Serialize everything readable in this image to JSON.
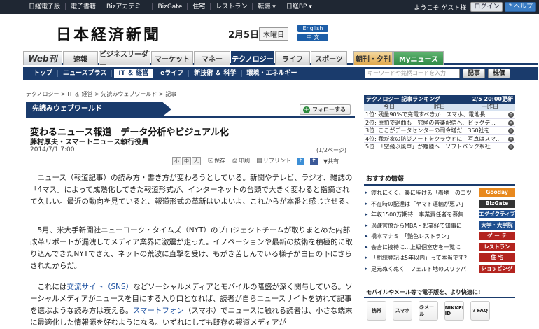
{
  "topbar": {
    "links": [
      "日経電子版",
      "電子書籍",
      "Bizアカデミー",
      "BizGate",
      "住宅",
      "レストラン",
      "転職 ▾",
      "日経BP ▾"
    ],
    "greeting": "ようこそ ゲスト様",
    "login": "ログイン",
    "help": "? ヘルプ"
  },
  "header": {
    "logo": "日本経済新聞",
    "date": "2月5日",
    "weekday": "木曜日",
    "lang_en": "English",
    "lang_cn": "中 文"
  },
  "mainnav": {
    "web": "Web刊",
    "tabs": [
      "速報",
      "ビジネスリーダー",
      "マーケット",
      "マネー",
      "テクノロジー",
      "ライフ",
      "スポーツ"
    ],
    "yuukan": "朝刊・夕刊",
    "mynews": "Myニュース"
  },
  "subnav": {
    "items": [
      "トップ",
      "ニュースプラス",
      "IT ＆ 経営",
      "eライフ",
      "新技術 ＆ 科学",
      "環境・エネルギー"
    ],
    "search_placeholder": "キーワードや銘柄コードを入力",
    "btn_article": "記事",
    "btn_stock": "株価"
  },
  "article": {
    "breadcrumb": "テクノロジー > IT ＆ 経営 > 先読みウェブワールド > 記事",
    "section": "先読みウェブワールド",
    "follow": "フォローする",
    "title": "変わるニュース報道　データ分析やビジュアル化",
    "author": "藤村厚夫・スマートニュース執行役員",
    "date": "2014/7/1 7:00",
    "page_indicator": "(1/2ページ)",
    "font_sizes": [
      "小",
      "中",
      "大"
    ],
    "tools": {
      "save": "保存",
      "print": "印刷",
      "reprint": "リプリント",
      "share": "共有"
    },
    "p1": "ニュース（報道記事）の読み方・書き方が変わろうとしている。新聞やテレビ、ラジオ、雑誌の「4マス」によって成熟化してきた報道形式が、インターネットの台頭で大きく変わると指摘されて久しい。最近の動向を見ていると、報道形式の革新はいよいよ、これからが本番と感じさせる。",
    "p2": "5月、米大手新聞社ニューヨーク・タイムズ（NYT）のプロジェクトチームが取りまとめた内部改革リポートが漏洩してメディア業界に激震が走った。イノベーションや最新の技術を積極的に取り込んできたNYTでさえ、ネットの荒波に直撃を受け、もがき苦しんでいる様子が白日の下にさらされたからだ。",
    "p3_a": "これには",
    "p3_link1": "交流サイト（SNS）",
    "p3_b": "などソーシャルメディアとモバイルの隆盛が深く関与している。ソーシャルメディアがニュースを目にする入り口となれば、読者が自らニュースサイトを訪れて記事を選ぶような読み方は衰える。",
    "p3_link2": "スマートフォン",
    "p3_c": "（スマホ）でニュースに触れる読者は、小さな端末に最適化した情報源を好むようになる。いずれにしても既存の報道メディアが"
  },
  "ranking": {
    "title": "テクノロジー 記事ランキング",
    "timestamp": "2/5 20:00更新",
    "cols": [
      "今日",
      "昨日",
      "一昨日"
    ],
    "rows": [
      "1位: 残量90%で充電すべきか　スマホ、電池長...",
      "2位: 原拍で退曲も　究極の音楽配信へ、ビッグデ...",
      "3位: ここがデータセンターの司令塔だ　350社を...",
      "4位: 我が家の防災ノートをクラウドに　写真はスマ...",
      "5位: 「空飛ぶ風車」が離陸へ　ソフトバンク系社..."
    ]
  },
  "recommend": {
    "title": "おすすめ情報",
    "items": [
      {
        "text": "疲れにくく、楽に歩ける「着地」のコツ",
        "badge": "Gooday",
        "color": "#e8891e"
      },
      {
        "text": "不在時の配達は「ヤマト運輸が悪い」",
        "badge": "BizGate",
        "color": "#333333"
      },
      {
        "text": "年収1500万期待　事業責任者を募集",
        "badge": "エグゼクティブ",
        "color": "#1f4e8f"
      },
      {
        "text": "過疎官僚からMBA・起業経て知事に",
        "badge": "大学・大学院",
        "color": "#1f4e8f"
      },
      {
        "text": "橋本マナミ　「艶色レストラン」",
        "badge": "ゲ ー テ",
        "color": "#b3241f"
      },
      {
        "text": "会合に接待に…上級個室店を一覧に",
        "badge": "レストラン",
        "color": "#b3241f"
      },
      {
        "text": "「相続登記は5年以内」って本当です?",
        "badge": "住 宅",
        "color": "#b3241f"
      },
      {
        "text": "足元ぬくぬく　フェルト地のスリッパ",
        "badge": "ショッピング",
        "color": "#b3241f"
      }
    ]
  },
  "mobile": {
    "title": "モバイルやメール等で電子版を、より快適に!",
    "icons": [
      "携帯",
      "スマホ",
      "@メール",
      "NIKKEI ID",
      "? FAQ"
    ]
  }
}
